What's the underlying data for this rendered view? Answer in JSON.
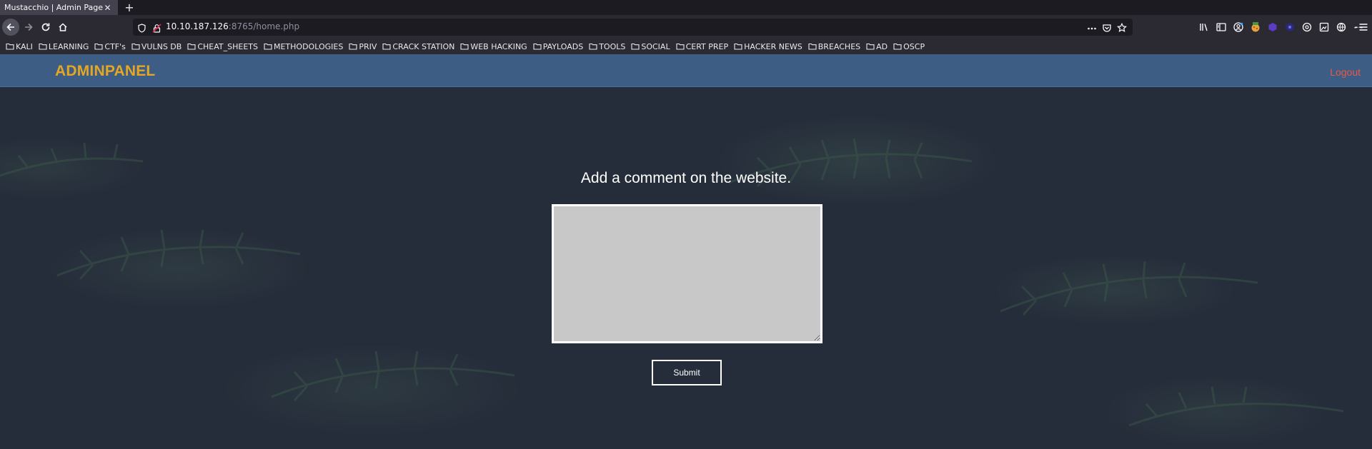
{
  "browser": {
    "tab": {
      "title": "Mustacchio | Admin Page"
    },
    "url": {
      "host": "10.10.187.126",
      "rest": ":8765/home.php"
    }
  },
  "bookmarks": [
    {
      "label": "KALI"
    },
    {
      "label": "LEARNING"
    },
    {
      "label": "CTF's"
    },
    {
      "label": "VULNS DB"
    },
    {
      "label": "CHEAT_SHEETS"
    },
    {
      "label": "METHODOLOGIES"
    },
    {
      "label": "PRIV"
    },
    {
      "label": "CRACK STATION"
    },
    {
      "label": "WEB HACKING"
    },
    {
      "label": "PAYLOADS"
    },
    {
      "label": "TOOLS"
    },
    {
      "label": "SOCIAL"
    },
    {
      "label": "CERT PREP"
    },
    {
      "label": "HACKER NEWS"
    },
    {
      "label": "BREACHES"
    },
    {
      "label": "AD"
    },
    {
      "label": "OSCP"
    }
  ],
  "page": {
    "brand": "ADMINPANEL",
    "logout": "Logout",
    "heading": "Add a comment on the website.",
    "comment_value": "",
    "submit_label": "Submit"
  },
  "colors": {
    "header_bg": "#3d5d84",
    "brand": "#e3a725",
    "logout": "#e55a4a",
    "page_bg": "#252d3a"
  }
}
